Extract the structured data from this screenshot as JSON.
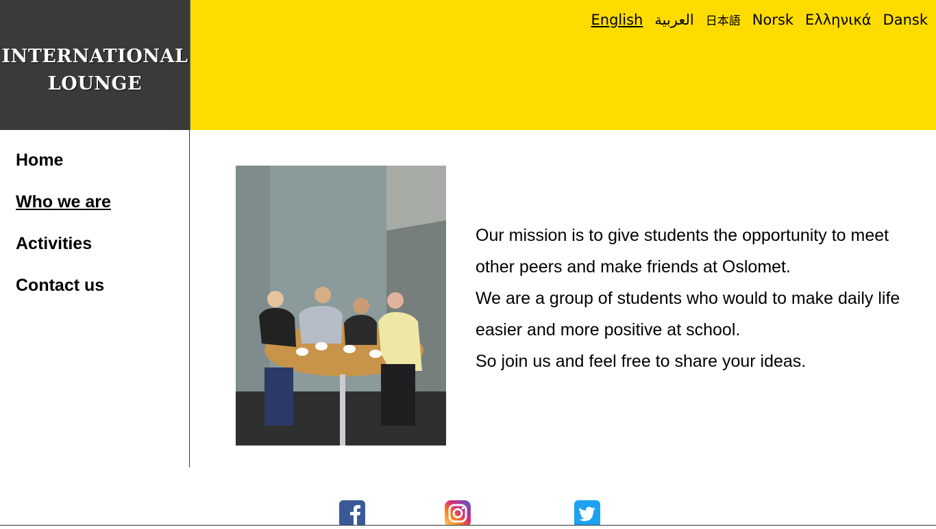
{
  "logo": {
    "line1": "INTERNATIONAL",
    "line2": "LOUNGE"
  },
  "languages": [
    {
      "label": "English",
      "active": true
    },
    {
      "label": "العربية"
    },
    {
      "label": "日本語"
    },
    {
      "label": "Norsk"
    },
    {
      "label": "Ελληνικά"
    },
    {
      "label": "Dansk"
    }
  ],
  "nav": [
    {
      "label": "Home"
    },
    {
      "label": "Who we are",
      "active": true
    },
    {
      "label": "Activities"
    },
    {
      "label": "Contact us"
    }
  ],
  "mission": [
    "Our mission is to give students the opportunity to meet other peers and make friends at Oslomet.",
    "We are a group of students who would to make daily life easier and more positive at school.",
    "So join us and feel free to share your ideas."
  ],
  "social": [
    "facebook-icon",
    "instagram-icon",
    "twitter-icon"
  ],
  "colors": {
    "banner": "#ffdc00",
    "logo_bg": "#3a3a3a",
    "facebook": "#3b5998",
    "twitter": "#1da1f2"
  }
}
